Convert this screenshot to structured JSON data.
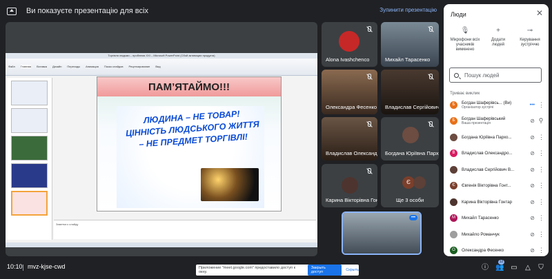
{
  "topbar": {
    "presenting_text": "Ви показуєте презентацію для всіх",
    "stop_label": "Зупинити презентацію"
  },
  "presentation": {
    "window_title": "Торгівля людьми – проблема ХХІ – Microsoft PowerPoint (Сбой активации продукта)",
    "ribbon_tabs": [
      "Файл",
      "Главная",
      "Вставка",
      "Дизайн",
      "Переходы",
      "Анимация",
      "Показ слайдов",
      "Рецензирование",
      "Вид"
    ],
    "slide_title": "ПАМ’ЯТАЙМО!!!",
    "slogan": "ЛЮДИНА – НЕ ТОВАР! ЦІННІСТЬ ЛЮДСЬКОГО ЖИТТЯ – НЕ ПРЕДМЕТ ТОРГІВЛІ!",
    "notes_placeholder": "Заметки к слайду",
    "thumb_count": 4
  },
  "participants_grid": [
    {
      "name": "Alona Ivashchenco",
      "avatar_color": "#c62828",
      "type": "avatar"
    },
    {
      "name": "Михайл Тарасенко",
      "type": "video"
    },
    {
      "name": "Олександра Фесенко",
      "type": "video"
    },
    {
      "name": "Владислав Сергійович",
      "type": "video"
    },
    {
      "name": "Владислав Олександр...",
      "type": "video"
    },
    {
      "name": "Богдана Юріївна Пархо...",
      "type": "video"
    },
    {
      "name": "Карина Вікторівна Гонт...",
      "type": "avatar"
    },
    {
      "name": "Ще 3 особи",
      "type": "group"
    }
  ],
  "self_tile": {
    "type": "video"
  },
  "people_panel": {
    "title": "Люди",
    "controls": [
      {
        "label": "Мікрофони всіх учасників вимкнено",
        "icon": "mic-off-icon"
      },
      {
        "label": "Додати людей",
        "icon": "add-person-icon"
      },
      {
        "label": "Керування зустріччю",
        "icon": "toggle-icon"
      }
    ],
    "search_placeholder": "Пошук людей",
    "section_label": "Триває виклик",
    "people": [
      {
        "name": "Богдан Шаферівсь... (Ви)",
        "sub": "Організатор зустрічі",
        "color": "#e8711a",
        "initial": "Б"
      },
      {
        "name": "Богдан Шаферівський",
        "sub": "Ваша презентація",
        "color": "#e8711a",
        "initial": "Б"
      },
      {
        "name": "Богдана Юріївна Пархо...",
        "sub": "",
        "color": "#6d4c41",
        "initial": ""
      },
      {
        "name": "Владислав Олександро...",
        "sub": "",
        "color": "#d81b60",
        "initial": "В"
      },
      {
        "name": "Владислав Сергійович В...",
        "sub": "",
        "color": "#5d4037",
        "initial": ""
      },
      {
        "name": "Євгенія Вікторівна Гонт...",
        "sub": "",
        "color": "#7b3f2b",
        "initial": "Є"
      },
      {
        "name": "Карина Вікторівна Гонтар",
        "sub": "",
        "color": "#4e342e",
        "initial": ""
      },
      {
        "name": "Михайл Тарасенко",
        "sub": "",
        "color": "#ad1457",
        "initial": "М"
      },
      {
        "name": "Михайло Романчук",
        "sub": "",
        "color": "#9e9e9e",
        "initial": ""
      },
      {
        "name": "Олександра Фесенко",
        "sub": "",
        "color": "#1b5e20",
        "initial": "О"
      },
      {
        "name": "",
        "sub": "",
        "color": "#8e8e8e",
        "initial": ""
      }
    ]
  },
  "bottombar": {
    "time": "10:10",
    "meeting_code": "mvz-kjse-cwd",
    "notice_text": "Приложение \"meet.google.com\" предоставило доступ к окну.",
    "notice_button": "Закрыть доступ",
    "notice_hide": "Скрыть",
    "people_count": "12"
  }
}
